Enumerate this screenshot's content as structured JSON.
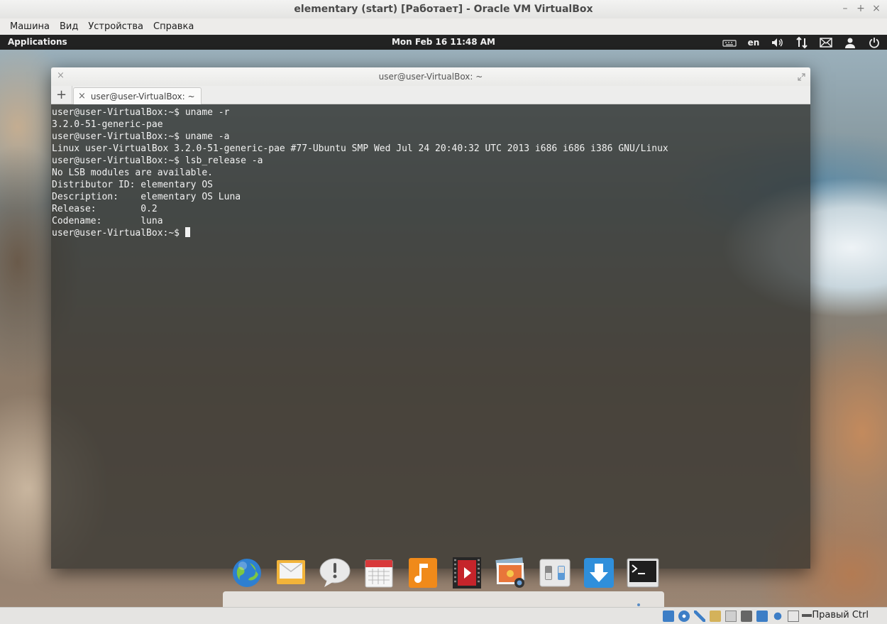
{
  "host_window": {
    "title": "elementary (start) [Работает] - Oracle VM VirtualBox",
    "controls": [
      "–",
      "+",
      "×"
    ],
    "menu": [
      "Машина",
      "Вид",
      "Устройства",
      "Справка"
    ]
  },
  "top_panel": {
    "applications": "Applications",
    "clock": "Mon Feb 16 11:48 AM",
    "keyboard_layout": "en"
  },
  "terminal": {
    "title": "user@user-VirtualBox: ~",
    "new_tab": "+",
    "tab": {
      "close": "×",
      "label": "user@user-VirtualBox: ~"
    },
    "close": "×",
    "lines": [
      "user@user-VirtualBox:~$ uname -r",
      "3.2.0-51-generic-pae",
      "user@user-VirtualBox:~$ uname -a",
      "Linux user-VirtualBox 3.2.0-51-generic-pae #77-Ubuntu SMP Wed Jul 24 20:40:32 UTC 2013 i686 i686 i386 GNU/Linux",
      "user@user-VirtualBox:~$ lsb_release -a",
      "No LSB modules are available.",
      "Distributor ID:\telementary OS",
      "Description:\telementary OS Luna",
      "Release:\t0.2",
      "Codename:\tluna"
    ],
    "prompt": "user@user-VirtualBox:~$ "
  },
  "dock": {
    "items": [
      {
        "name": "web-browser-icon"
      },
      {
        "name": "mail-icon"
      },
      {
        "name": "notifications-icon"
      },
      {
        "name": "calendar-icon"
      },
      {
        "name": "music-icon"
      },
      {
        "name": "videos-icon"
      },
      {
        "name": "photos-icon"
      },
      {
        "name": "system-settings-icon"
      },
      {
        "name": "software-center-icon"
      },
      {
        "name": "terminal-icon"
      }
    ]
  },
  "statusbar": {
    "host_key": "Правый Ctrl"
  },
  "colors": {
    "panel": "#222222",
    "terminal_bg": "#30302d",
    "terminal_fg": "#f2f2f2",
    "accent_blue": "#3e8fd6"
  }
}
